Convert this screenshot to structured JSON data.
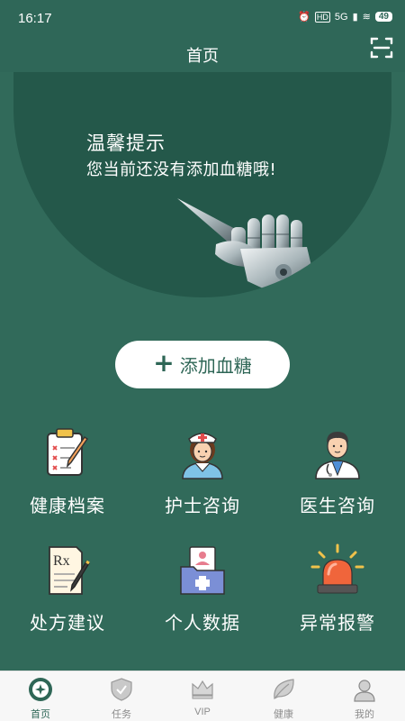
{
  "status": {
    "time": "16:17",
    "signal": "5G",
    "hd": "HD",
    "battery": "49"
  },
  "header": {
    "title": "首页"
  },
  "hero": {
    "title": "温馨提示",
    "message": "您当前还没有添加血糖哦!"
  },
  "add_button": {
    "icon": "+",
    "label": "添加血糖"
  },
  "grid": [
    {
      "label": "健康档案",
      "icon": "clipboard-icon"
    },
    {
      "label": "护士咨询",
      "icon": "nurse-icon"
    },
    {
      "label": "医生咨询",
      "icon": "doctor-icon"
    },
    {
      "label": "处方建议",
      "icon": "prescription-icon"
    },
    {
      "label": "个人数据",
      "icon": "personal-data-icon"
    },
    {
      "label": "异常报警",
      "icon": "alarm-icon"
    }
  ],
  "tabs": [
    {
      "label": "首页",
      "icon": "home-icon",
      "active": true
    },
    {
      "label": "任务",
      "icon": "shield-icon"
    },
    {
      "label": "VIP",
      "icon": "crown-icon"
    },
    {
      "label": "健康",
      "icon": "leaf-icon"
    },
    {
      "label": "我的",
      "icon": "profile-icon"
    }
  ],
  "colors": {
    "primary": "#316a5a",
    "hero": "#24584a",
    "active_tab": "#2e6656"
  }
}
